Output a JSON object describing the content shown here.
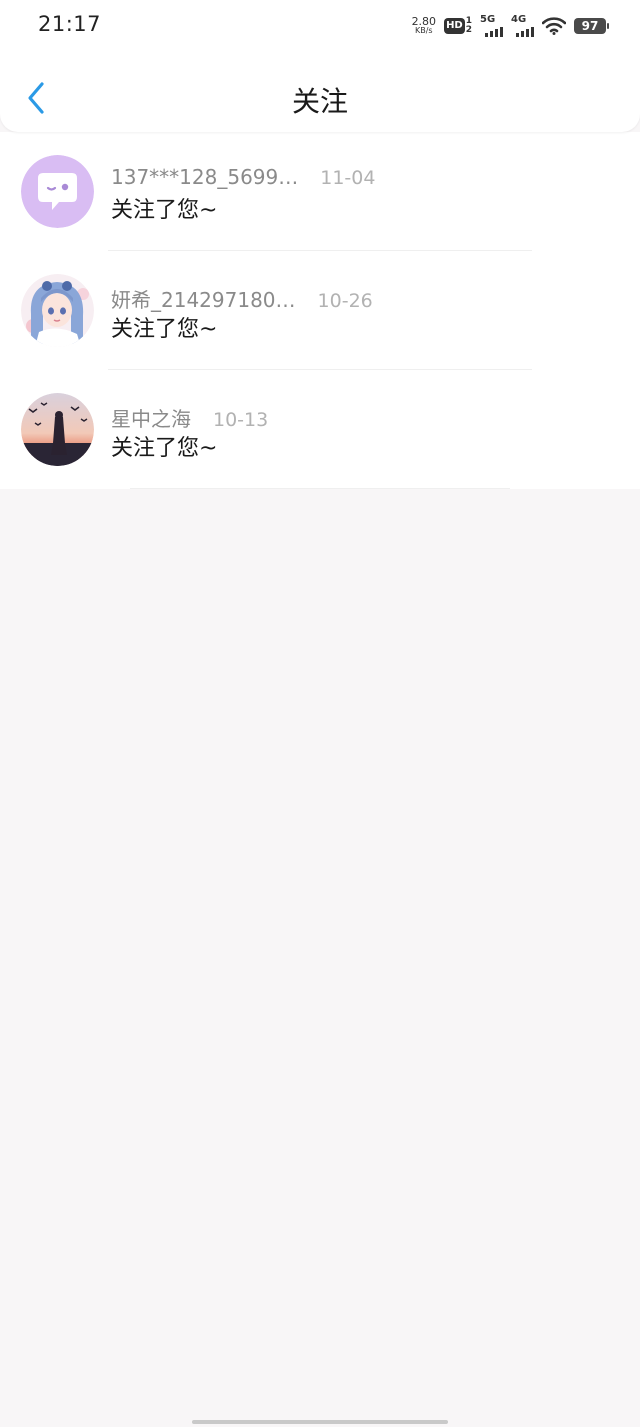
{
  "status_bar": {
    "time": "21:17",
    "net_speed_value": "2.80",
    "net_speed_unit": "KB/s",
    "hd_label": "HD",
    "hd_sim_1": "1",
    "hd_sim_2": "2",
    "signal_1_label": "5G",
    "signal_2_label": "4G",
    "battery": "97",
    "icons": [
      "hd-icon",
      "signal-5g-icon",
      "signal-4g-icon",
      "wifi-icon",
      "battery-icon"
    ]
  },
  "header": {
    "title": "关注",
    "back_icon": "chevron-left-icon",
    "accent_color": "#2b9ae6"
  },
  "notifications": [
    {
      "name": "137***128_5699…",
      "date": "11-04",
      "message": "关注了您~",
      "avatar": "chat-bubble-avatar"
    },
    {
      "name": "妍希_214297180…",
      "date": "10-26",
      "message": "关注了您~",
      "avatar": "anime-girl-avatar"
    },
    {
      "name": "星中之海",
      "date": "10-13",
      "message": "关注了您~",
      "avatar": "sunset-birds-avatar"
    }
  ],
  "colors": {
    "page_background": "#f8f6f7",
    "name_text": "#8a8a8a",
    "date_text": "#b2b2b2",
    "message_text": "#1a1a1a",
    "default_avatar_bg": "#d9bdf3"
  }
}
